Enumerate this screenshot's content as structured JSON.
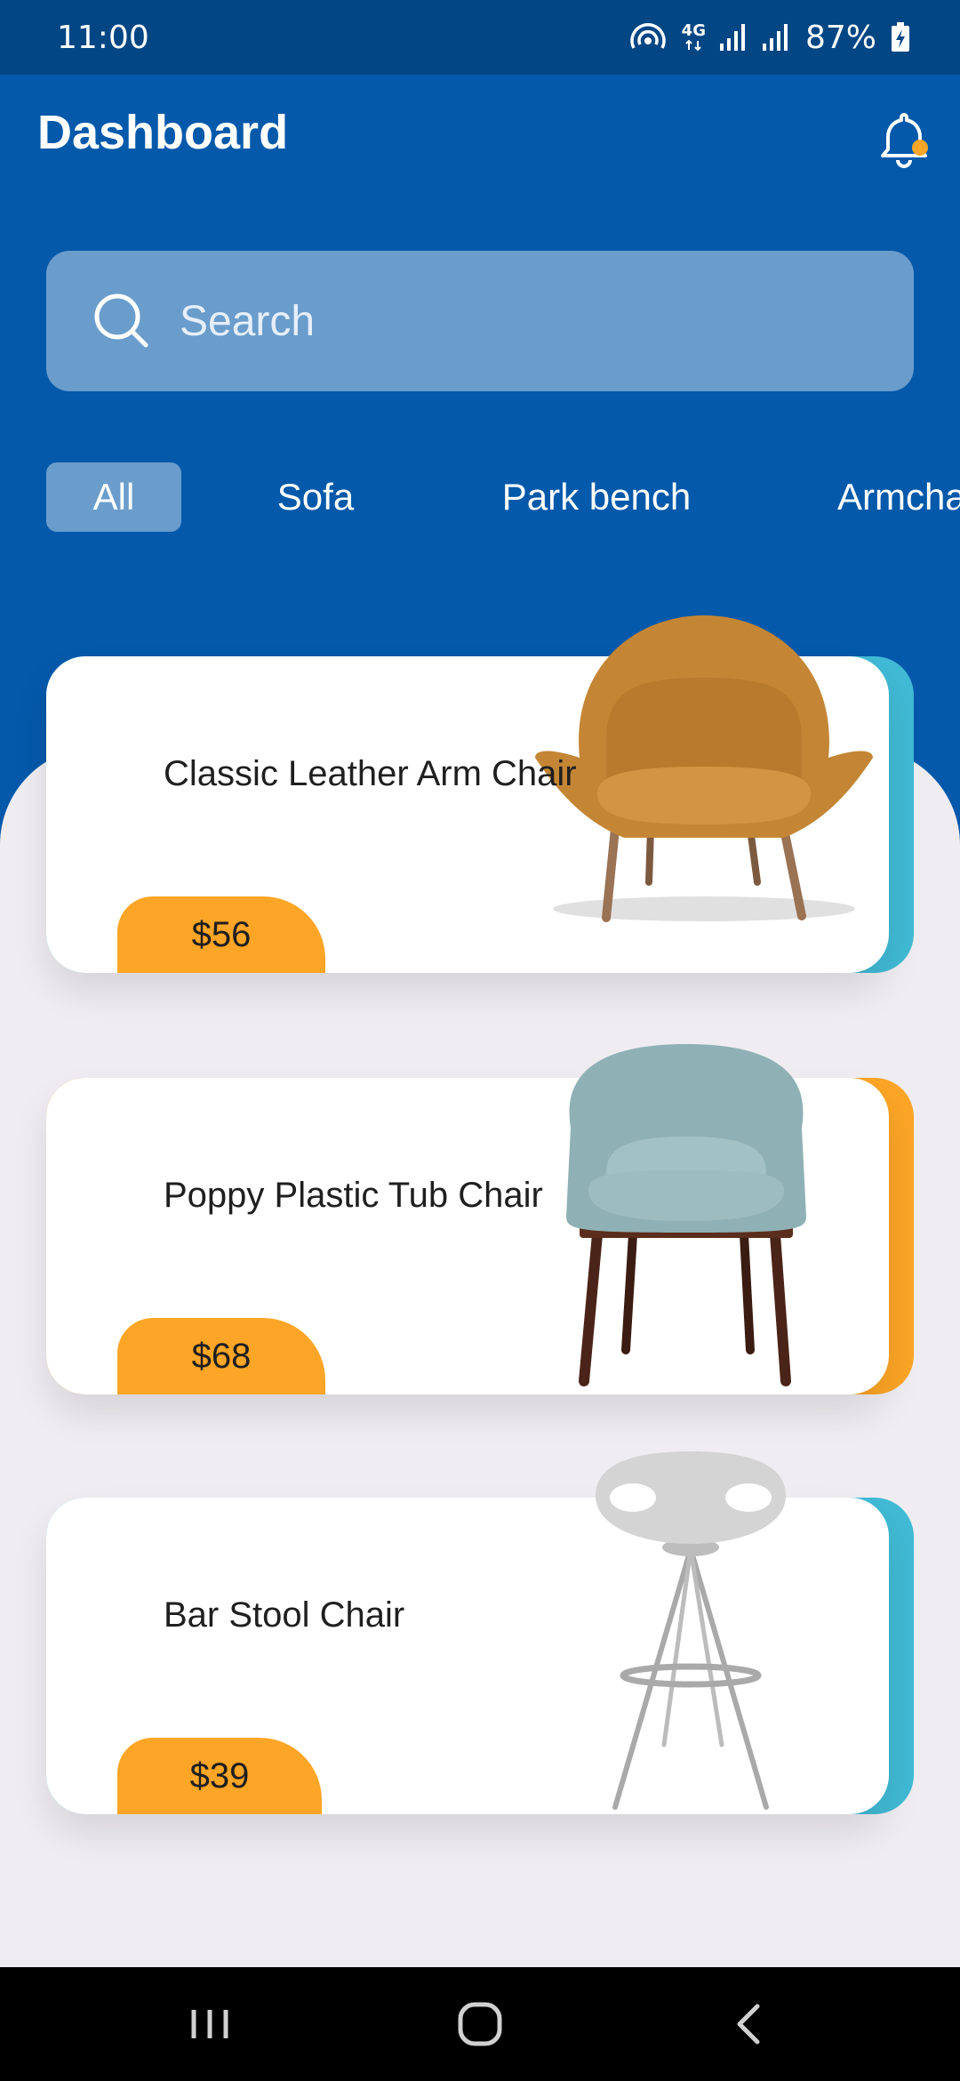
{
  "status_bar": {
    "time": "11:00",
    "network": "4G",
    "battery": "87%",
    "icons": [
      "hotspot-icon",
      "network-4g-icon",
      "signal-icon",
      "signal-icon",
      "battery-charging-icon"
    ]
  },
  "header": {
    "title": "Dashboard",
    "notification_icon": "bell-icon",
    "has_notification_dot": true
  },
  "search": {
    "placeholder": "Search",
    "value": "",
    "icon": "search-icon"
  },
  "categories": [
    {
      "label": "All",
      "active": true
    },
    {
      "label": "Sofa",
      "active": false
    },
    {
      "label": "Park bench",
      "active": false
    },
    {
      "label": "Armchair",
      "active": false
    }
  ],
  "products": [
    {
      "title": "Classic Leather Arm Chair",
      "price": "$56",
      "accent_color": "#41bad5",
      "image": "armchair-image"
    },
    {
      "title": "Poppy Plastic Tub Chair",
      "price": "$68",
      "accent_color": "#fca526",
      "image": "tub-chair-image"
    },
    {
      "title": "Bar Stool Chair",
      "price": "$39",
      "accent_color": "#41bad5",
      "image": "bar-stool-image"
    }
  ],
  "nav_bar": {
    "buttons": [
      "recent-apps-icon",
      "home-icon",
      "back-icon"
    ]
  },
  "colors": {
    "primary": "#0459aa",
    "status_bar": "#034684",
    "price_tag": "#fca526",
    "accent_teal": "#41bad5",
    "notification_dot": "#fca526"
  }
}
